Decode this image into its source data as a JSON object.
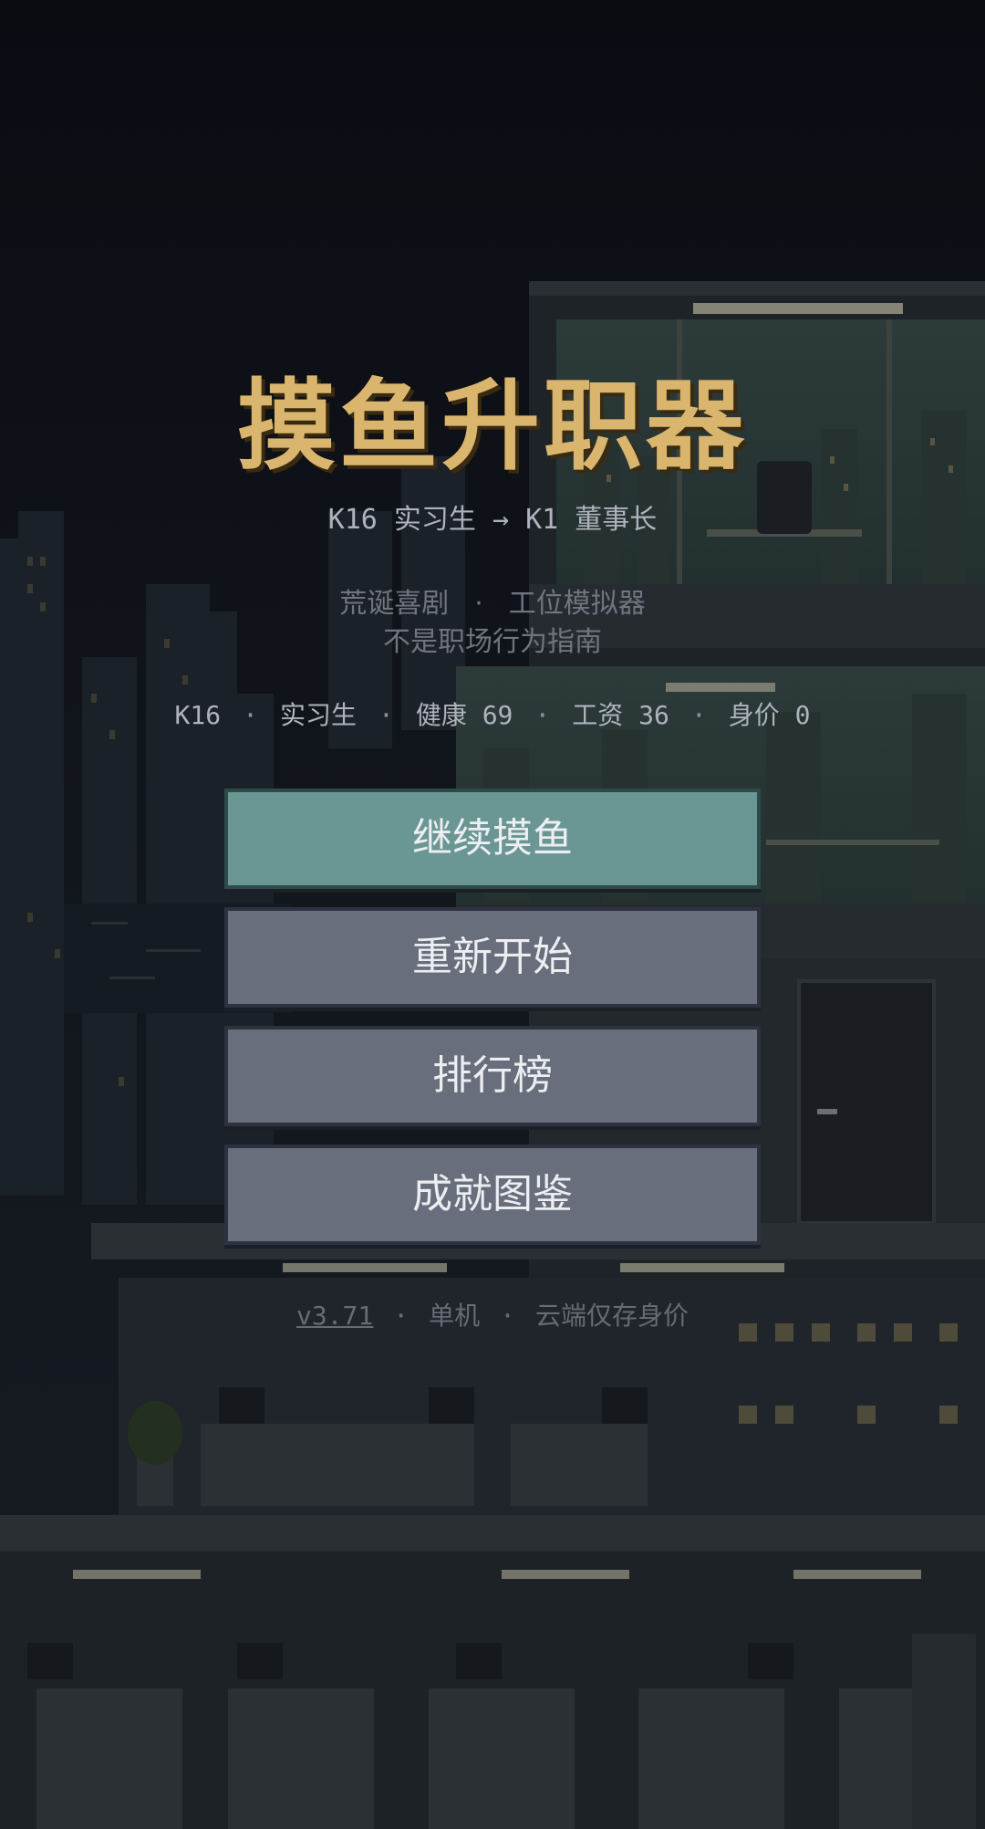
{
  "game": {
    "title": "摸鱼升职器",
    "subtitle": "K16 实习生 → K1 董事长"
  },
  "tagline": {
    "part1": "荒诞喜剧",
    "sep": "·",
    "part2": "工位模拟器",
    "line2": "不是职场行为指南"
  },
  "stats": {
    "level": "K16",
    "role": "实习生",
    "health_label": "健康",
    "health_value": "69",
    "salary_label": "工资",
    "salary_value": "36",
    "worth_label": "身价",
    "worth_value": "0",
    "sep": "·"
  },
  "menu": {
    "continue_label": "继续摸鱼",
    "restart_label": "重新开始",
    "leaderboard_label": "排行榜",
    "achievements_label": "成就图鉴"
  },
  "footer": {
    "version": "v3.71",
    "mode": "单机",
    "cloud_note": "云端仅存身价",
    "sep": "·"
  },
  "colors": {
    "title": "#d9b56e",
    "primary_button": "#6a9793",
    "secondary_button": "#686e7b",
    "background": "#0b0d12"
  }
}
